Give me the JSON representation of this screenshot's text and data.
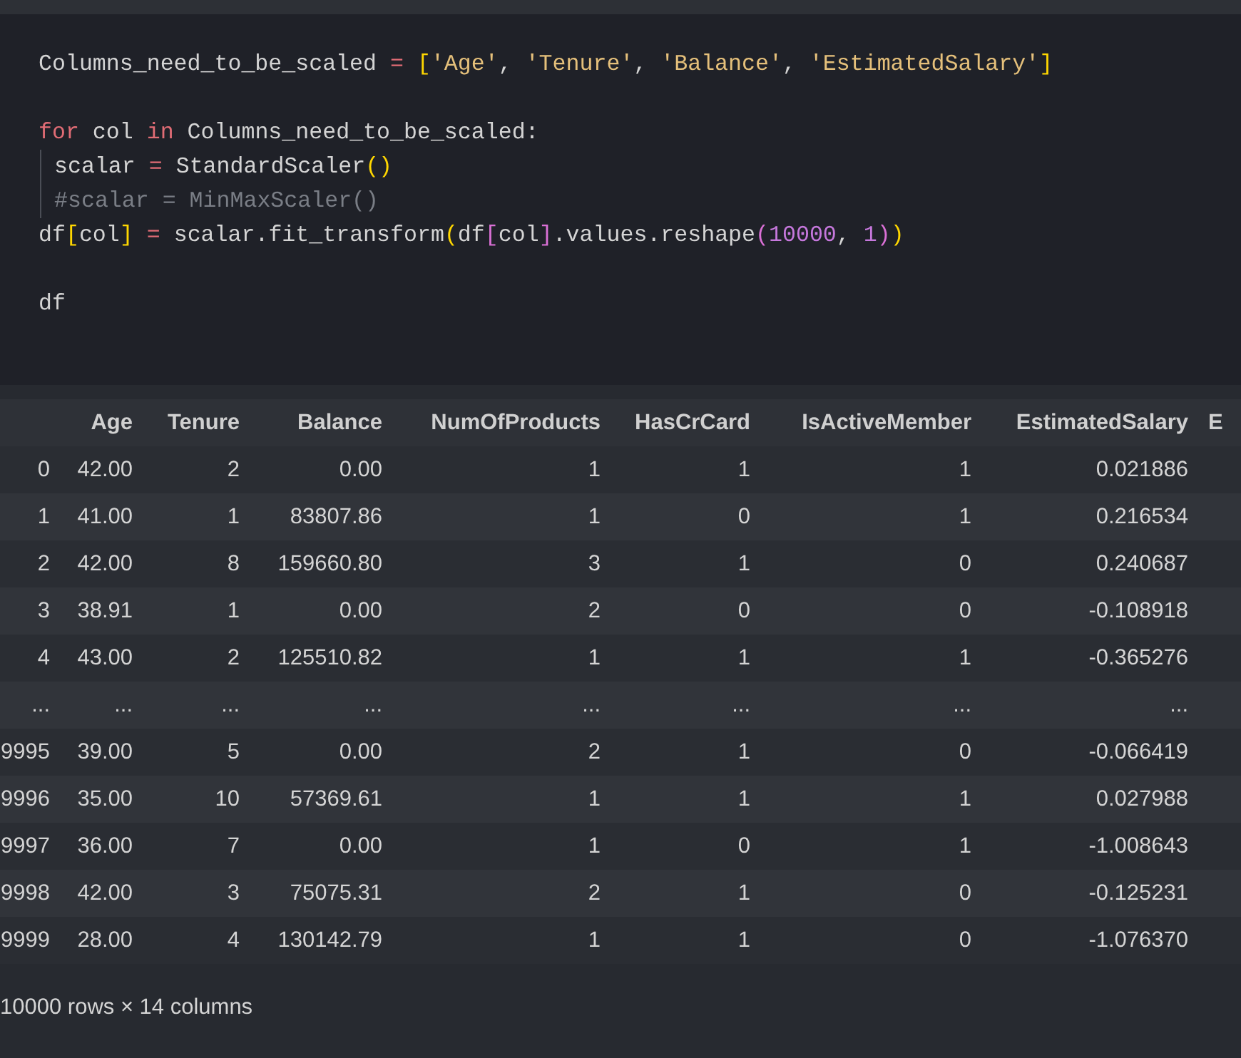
{
  "code_cell": {
    "lines": [
      {
        "indented": false,
        "tokens": [
          {
            "kind": "plain",
            "text": "Columns_need_to_be_scaled"
          },
          {
            "kind": "operator",
            "text": " = "
          },
          {
            "kind": "bracket1",
            "text": "["
          },
          {
            "kind": "string",
            "text": "'Age'"
          },
          {
            "kind": "plain",
            "text": ", "
          },
          {
            "kind": "string",
            "text": "'Tenure'"
          },
          {
            "kind": "plain",
            "text": ", "
          },
          {
            "kind": "string",
            "text": "'Balance'"
          },
          {
            "kind": "plain",
            "text": ", "
          },
          {
            "kind": "string",
            "text": "'EstimatedSalary'"
          },
          {
            "kind": "bracket1",
            "text": "]"
          }
        ]
      },
      {
        "indented": false
      },
      {
        "indented": false,
        "tokens": [
          {
            "kind": "keyword",
            "text": "for"
          },
          {
            "kind": "plain",
            "text": " col "
          },
          {
            "kind": "keyword",
            "text": "in"
          },
          {
            "kind": "plain",
            "text": " Columns_need_to_be_scaled:"
          }
        ]
      },
      {
        "indented": true,
        "tokens": [
          {
            "kind": "plain",
            "text": "scalar"
          },
          {
            "kind": "operator",
            "text": " = "
          },
          {
            "kind": "plain",
            "text": "StandardScaler"
          },
          {
            "kind": "bracket1",
            "text": "()"
          }
        ]
      },
      {
        "indented": true,
        "tokens": [
          {
            "kind": "comment",
            "text": "#scalar = MinMaxScaler()"
          }
        ]
      },
      {
        "indented": false,
        "tokens": [
          {
            "kind": "plain",
            "text": "df"
          },
          {
            "kind": "bracket1",
            "text": "["
          },
          {
            "kind": "plain",
            "text": "col"
          },
          {
            "kind": "bracket1",
            "text": "]"
          },
          {
            "kind": "operator",
            "text": " = "
          },
          {
            "kind": "plain",
            "text": "scalar.fit_transform"
          },
          {
            "kind": "bracket1",
            "text": "("
          },
          {
            "kind": "plain",
            "text": "df"
          },
          {
            "kind": "bracket2",
            "text": "["
          },
          {
            "kind": "plain",
            "text": "col"
          },
          {
            "kind": "bracket2",
            "text": "]"
          },
          {
            "kind": "plain",
            "text": ".values.reshape"
          },
          {
            "kind": "bracket2",
            "text": "("
          },
          {
            "kind": "number",
            "text": "10000"
          },
          {
            "kind": "plain",
            "text": ", "
          },
          {
            "kind": "number",
            "text": "1"
          },
          {
            "kind": "bracket2",
            "text": ")"
          },
          {
            "kind": "bracket1",
            "text": ")"
          }
        ]
      },
      {
        "indented": false
      },
      {
        "indented": false,
        "tokens": [
          {
            "kind": "plain",
            "text": "df"
          }
        ]
      }
    ]
  },
  "output": {
    "table": {
      "columns": [
        "",
        "Age",
        "Tenure",
        "Balance",
        "NumOfProducts",
        "HasCrCard",
        "IsActiveMember",
        "EstimatedSalary",
        "E"
      ],
      "rows": [
        [
          "0",
          "42.00",
          "2",
          "0.00",
          "1",
          "1",
          "1",
          "0.021886"
        ],
        [
          "1",
          "41.00",
          "1",
          "83807.86",
          "1",
          "0",
          "1",
          "0.216534"
        ],
        [
          "2",
          "42.00",
          "8",
          "159660.80",
          "3",
          "1",
          "0",
          "0.240687"
        ],
        [
          "3",
          "38.91",
          "1",
          "0.00",
          "2",
          "0",
          "0",
          "-0.108918"
        ],
        [
          "4",
          "43.00",
          "2",
          "125510.82",
          "1",
          "1",
          "1",
          "-0.365276"
        ],
        [
          "...",
          "...",
          "...",
          "...",
          "...",
          "...",
          "...",
          "..."
        ],
        [
          "9995",
          "39.00",
          "5",
          "0.00",
          "2",
          "1",
          "0",
          "-0.066419"
        ],
        [
          "9996",
          "35.00",
          "10",
          "57369.61",
          "1",
          "1",
          "1",
          "0.027988"
        ],
        [
          "9997",
          "36.00",
          "7",
          "0.00",
          "1",
          "0",
          "1",
          "-1.008643"
        ],
        [
          "9998",
          "42.00",
          "3",
          "75075.31",
          "2",
          "1",
          "0",
          "-0.125231"
        ],
        [
          "9999",
          "28.00",
          "4",
          "130142.79",
          "1",
          "1",
          "0",
          "-1.076370"
        ]
      ]
    },
    "summary": "10000 rows × 14 columns"
  }
}
